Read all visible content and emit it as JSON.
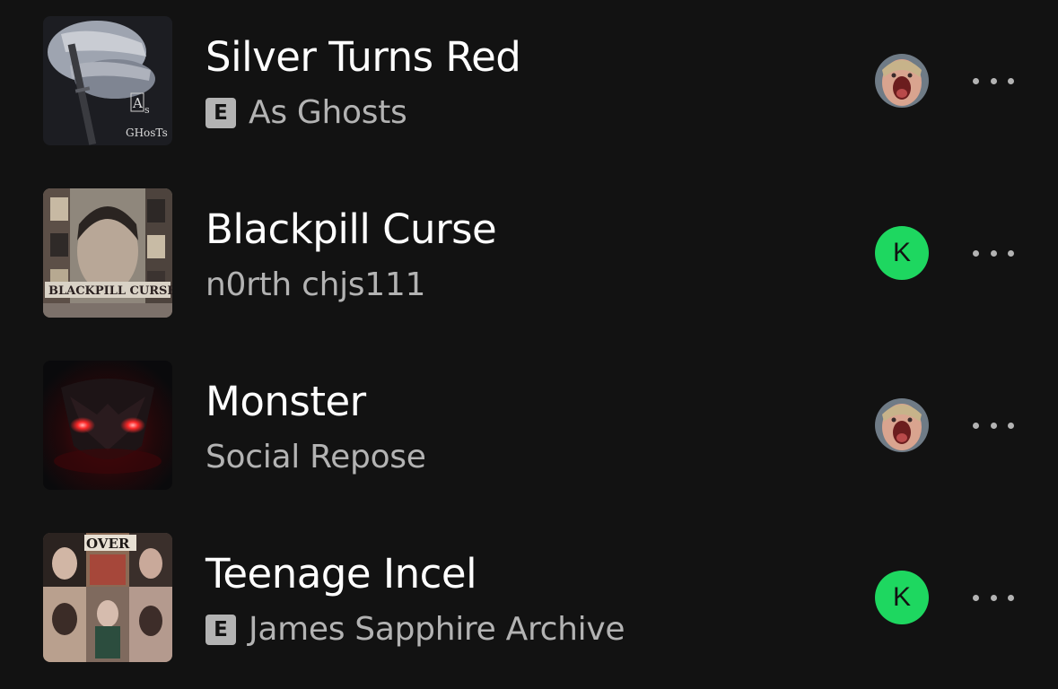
{
  "tracks": [
    {
      "title": "Silver Turns Red",
      "artist": "As Ghosts",
      "explicit": true,
      "explicit_label": "E",
      "cover_text": [
        "A",
        "s",
        "GHosTs"
      ],
      "added_by": {
        "type": "photo",
        "letter": ""
      }
    },
    {
      "title": "Blackpill Curse",
      "artist": "n0rth chjs111",
      "explicit": false,
      "explicit_label": "",
      "cover_text": [
        "BLACKPILL CURSE"
      ],
      "added_by": {
        "type": "letter",
        "letter": "K"
      }
    },
    {
      "title": "Monster",
      "artist": "Social Repose",
      "explicit": false,
      "explicit_label": "",
      "cover_text": [],
      "added_by": {
        "type": "photo",
        "letter": ""
      }
    },
    {
      "title": "Teenage Incel",
      "artist": "James Sapphire Archive",
      "explicit": true,
      "explicit_label": "E",
      "cover_text": [
        "OVER"
      ],
      "added_by": {
        "type": "letter",
        "letter": "K"
      }
    }
  ],
  "icons": {
    "more": "more-options-icon",
    "explicit": "explicit-badge"
  },
  "colors": {
    "background": "#121212",
    "title": "#ffffff",
    "subtitle": "#b3b3b3",
    "avatar_green": "#1ed760"
  }
}
